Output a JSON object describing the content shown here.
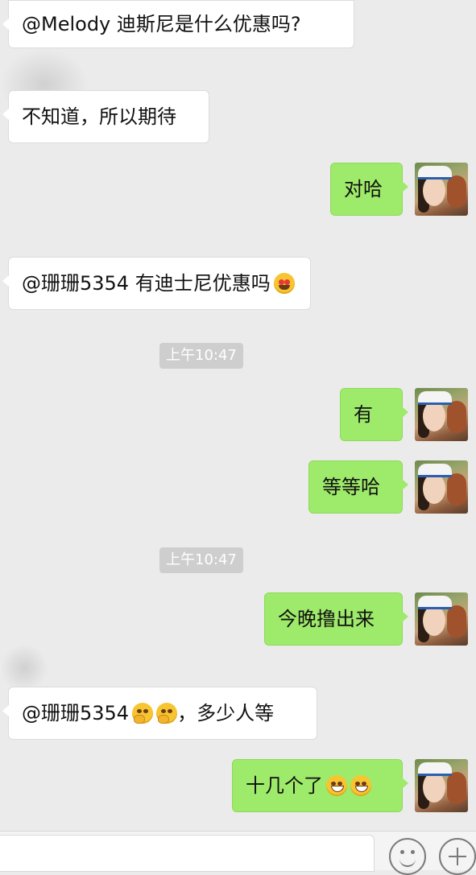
{
  "messages": [
    {
      "text": "@Melody  迪斯尼是什么优惠吗?"
    },
    {
      "text": "不知道，所以期待"
    },
    {
      "text": "对哈"
    },
    {
      "text": "@珊珊5354 有迪士尼优惠吗"
    },
    {
      "text": "有"
    },
    {
      "text": "等等哈"
    },
    {
      "text": "今晚撸出来"
    },
    {
      "text": "@珊珊5354 ",
      "suffix": "，多少人等"
    },
    {
      "text": "十几个了"
    }
  ],
  "timestamps": [
    "上午10:47",
    "上午10:47"
  ],
  "emojis": {
    "heart_eyes": "smiling-face-with-heart-eyes",
    "thinking": "thinking-face",
    "grin": "grinning-face"
  },
  "colors": {
    "background": "#ebebeb",
    "incoming_bubble": "#ffffff",
    "outgoing_bubble": "#9eea6a",
    "timestamp_bg": "#cecece"
  },
  "input_bar": {
    "emoji_button": "emoji-face-icon",
    "plus_button": "plus-icon"
  }
}
